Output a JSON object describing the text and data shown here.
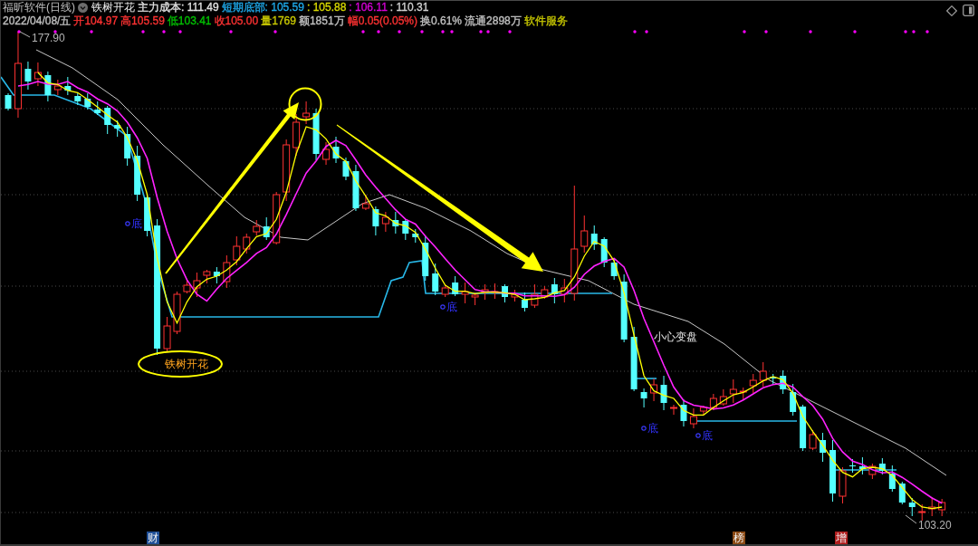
{
  "header": {
    "title": "福昕软件(日线)",
    "indicator": "铁树开花",
    "indicator_values": [
      {
        "text": "主力成本: 111.49",
        "color": "#e0e0e0"
      },
      {
        "text": "短期底部: 105.59",
        "color": "#1ea8e8"
      },
      {
        "text": ": 105.88",
        "color": "#d8d800"
      },
      {
        "text": ": 106.11",
        "color": "#d400d4"
      },
      {
        "text": ": 110.31",
        "color": "#d0d0d0"
      }
    ]
  },
  "quote": {
    "items": [
      {
        "text": "2022/04/08/五",
        "color": "#c0c0c0"
      },
      {
        "text": "开104.97",
        "color": "#ff3232"
      },
      {
        "text": "高105.59",
        "color": "#ff3232"
      },
      {
        "text": "低103.41",
        "color": "#00c000"
      },
      {
        "text": "收105.00",
        "color": "#ff3232"
      },
      {
        "text": "量1769",
        "color": "#c8c800"
      },
      {
        "text": "额1851万",
        "color": "#c0c0c0"
      },
      {
        "text": "幅0.05(0.05%)",
        "color": "#ff3232"
      },
      {
        "text": "换0.61%",
        "color": "#c0c0c0"
      },
      {
        "text": "流通2898万",
        "color": "#c0c0c0"
      },
      {
        "text": "软件服务",
        "color": "#c8c800"
      }
    ]
  },
  "chart": {
    "high_label": "177.90",
    "low_label": "103.20",
    "notes": [
      {
        "kind": "bottom",
        "text": "底"
      },
      {
        "kind": "bottom",
        "text": "底"
      },
      {
        "kind": "bottom",
        "text": "底"
      },
      {
        "kind": "bottom",
        "text": "底"
      },
      {
        "kind": "warning",
        "text": "小心变盘"
      },
      {
        "kind": "circled",
        "text": "铁树开花"
      }
    ],
    "tags": [
      {
        "text": "财",
        "color": "#1e4e96"
      },
      {
        "text": "榜",
        "color": "#8c4a14"
      },
      {
        "text": "增",
        "color": "#b01e1e"
      }
    ]
  }
}
